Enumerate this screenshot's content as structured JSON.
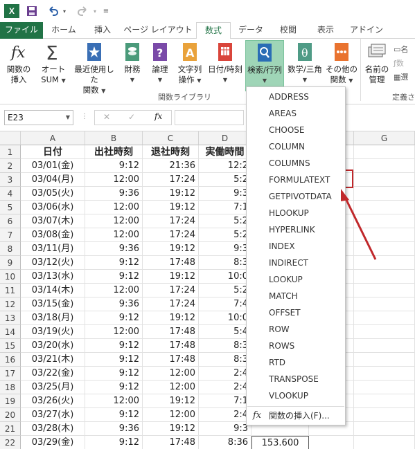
{
  "titlebar": {
    "logo": "X",
    "save_icon": "save-icon",
    "undo_icon": "undo-icon",
    "redo_icon": "redo-icon"
  },
  "tabs": [
    {
      "label": "ファイル"
    },
    {
      "label": "ホーム"
    },
    {
      "label": "挿入"
    },
    {
      "label": "ページ レイアウト"
    },
    {
      "label": "数式"
    },
    {
      "label": "データ"
    },
    {
      "label": "校閲"
    },
    {
      "label": "表示"
    },
    {
      "label": "アドイン"
    }
  ],
  "ribbon": {
    "buttons": [
      {
        "line1": "関数の",
        "line2": "挿入",
        "icon": "fx-icon"
      },
      {
        "line1": "オート",
        "line2": "SUM",
        "icon": "sigma-icon"
      },
      {
        "line1": "最近使用した",
        "line2": "関数",
        "icon": "star-book-icon"
      },
      {
        "line1": "財務",
        "line2": "",
        "icon": "finance-book-icon"
      },
      {
        "line1": "論理",
        "line2": "",
        "icon": "logic-book-icon"
      },
      {
        "line1": "文字列",
        "line2": "操作",
        "icon": "text-book-icon"
      },
      {
        "line1": "日付/時刻",
        "line2": "",
        "icon": "datetime-book-icon"
      },
      {
        "line1": "検索/行列",
        "line2": "",
        "icon": "lookup-book-icon"
      },
      {
        "line1": "数学/三角",
        "line2": "",
        "icon": "math-book-icon"
      },
      {
        "line1": "その他の",
        "line2": "関数",
        "icon": "more-book-icon"
      },
      {
        "line1": "名前の",
        "line2": "管理",
        "icon": "name-manager-icon"
      }
    ],
    "group_label": "関数ライブラリ",
    "partial_label": "定義さ",
    "side_labels": [
      "名",
      "数",
      "選"
    ]
  },
  "formula_bar": {
    "name_box": "E23",
    "fx": "fx",
    "cancel": "✕",
    "enter": "✓"
  },
  "columns": [
    "A",
    "B",
    "C",
    "D",
    "E",
    "F",
    "G"
  ],
  "headers": [
    "日付",
    "出社時刻",
    "退社時刻",
    "実働時間"
  ],
  "rows": [
    {
      "n": "1"
    },
    {
      "n": "2",
      "a": "03/01(金)",
      "b": "9:12",
      "c": "21:36",
      "d": "12:2"
    },
    {
      "n": "3",
      "a": "03/04(月)",
      "b": "12:00",
      "c": "17:24",
      "d": "5:2"
    },
    {
      "n": "4",
      "a": "03/05(火)",
      "b": "9:36",
      "c": "19:12",
      "d": "9:3"
    },
    {
      "n": "5",
      "a": "03/06(水)",
      "b": "12:00",
      "c": "19:12",
      "d": "7:1"
    },
    {
      "n": "6",
      "a": "03/07(木)",
      "b": "12:00",
      "c": "17:24",
      "d": "5:2"
    },
    {
      "n": "7",
      "a": "03/08(金)",
      "b": "12:00",
      "c": "17:24",
      "d": "5:2"
    },
    {
      "n": "8",
      "a": "03/11(月)",
      "b": "9:36",
      "c": "19:12",
      "d": "9:3"
    },
    {
      "n": "9",
      "a": "03/12(火)",
      "b": "9:12",
      "c": "17:48",
      "d": "8:3"
    },
    {
      "n": "10",
      "a": "03/13(水)",
      "b": "9:12",
      "c": "19:12",
      "d": "10:0"
    },
    {
      "n": "11",
      "a": "03/14(木)",
      "b": "12:00",
      "c": "17:24",
      "d": "5:2"
    },
    {
      "n": "12",
      "a": "03/15(金)",
      "b": "9:36",
      "c": "17:24",
      "d": "7:4"
    },
    {
      "n": "13",
      "a": "03/18(月)",
      "b": "9:12",
      "c": "19:12",
      "d": "10:0"
    },
    {
      "n": "14",
      "a": "03/19(火)",
      "b": "12:00",
      "c": "17:48",
      "d": "5:4"
    },
    {
      "n": "15",
      "a": "03/20(水)",
      "b": "9:12",
      "c": "17:48",
      "d": "8:3"
    },
    {
      "n": "16",
      "a": "03/21(木)",
      "b": "9:12",
      "c": "17:48",
      "d": "8:3"
    },
    {
      "n": "17",
      "a": "03/22(金)",
      "b": "9:12",
      "c": "12:00",
      "d": "2:4"
    },
    {
      "n": "18",
      "a": "03/25(月)",
      "b": "9:12",
      "c": "12:00",
      "d": "2:4"
    },
    {
      "n": "19",
      "a": "03/26(火)",
      "b": "12:00",
      "c": "19:12",
      "d": "7:1"
    },
    {
      "n": "20",
      "a": "03/27(水)",
      "b": "9:12",
      "c": "12:00",
      "d": "2:4"
    },
    {
      "n": "21",
      "a": "03/28(木)",
      "b": "9:36",
      "c": "19:12",
      "d": "9:3"
    },
    {
      "n": "22",
      "a": "03/29(金)",
      "b": "9:12",
      "c": "17:48",
      "d": "8:36",
      "e": "153.600"
    },
    {
      "n": "23"
    }
  ],
  "dropdown": {
    "items": [
      "ADDRESS",
      "AREAS",
      "CHOOSE",
      "COLUMN",
      "COLUMNS",
      "FORMULATEXT",
      "GETPIVOTDATA",
      "HLOOKUP",
      "HYPERLINK",
      "INDEX",
      "INDIRECT",
      "LOOKUP",
      "MATCH",
      "OFFSET",
      "ROW",
      "ROWS",
      "RTD",
      "TRANSPOSE",
      "VLOOKUP"
    ],
    "insert_label": "関数の挿入(F)...",
    "highlighted": "FORMULATEXT"
  },
  "colors": {
    "excel_green": "#217346",
    "selected_ribbon": "#9fd5b7",
    "annotation_red": "#c0282b"
  }
}
